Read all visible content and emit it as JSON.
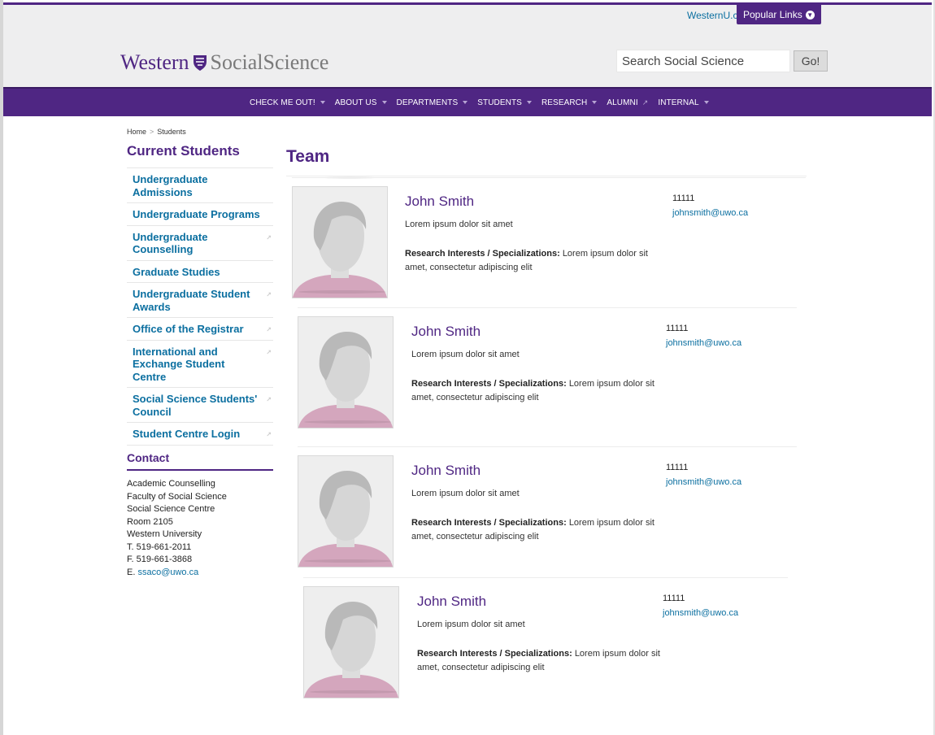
{
  "header": {
    "utility_link": "WesternU.ca",
    "popular_links": "Popular Links",
    "logo_western": "Western",
    "logo_social": "SocialScience",
    "search_placeholder": "Search Social Science",
    "go_label": "Go!"
  },
  "nav": {
    "items": [
      {
        "label": "CHECK ME OUT!",
        "icon": "caret-down-icon"
      },
      {
        "label": "ABOUT US",
        "icon": "caret-down-icon"
      },
      {
        "label": "DEPARTMENTS",
        "icon": "caret-down-icon"
      },
      {
        "label": "STUDENTS",
        "icon": "caret-down-icon"
      },
      {
        "label": "RESEARCH",
        "icon": "caret-down-icon"
      },
      {
        "label": "ALUMNI",
        "icon": "external-link-icon"
      },
      {
        "label": "INTERNAL",
        "icon": "caret-down-icon"
      }
    ]
  },
  "breadcrumb": {
    "home": "Home",
    "sep": ">",
    "current": "Students"
  },
  "sidebar": {
    "title": "Current Students",
    "items": [
      {
        "label": "Undergraduate Admissions",
        "external": false
      },
      {
        "label": "Undergraduate Programs",
        "external": false
      },
      {
        "label": "Undergraduate Counselling",
        "external": true
      },
      {
        "label": "Graduate Studies",
        "external": false
      },
      {
        "label": "Undergraduate Student Awards",
        "external": true
      },
      {
        "label": "Office of the Registrar",
        "external": true
      },
      {
        "label": "International and Exchange Student Centre",
        "external": true
      },
      {
        "label": "Social Science Students' Council",
        "external": true
      },
      {
        "label": "Student Centre Login",
        "external": true
      }
    ],
    "contact_title": "Contact",
    "contact_lines": [
      "Academic Counselling",
      "Faculty of Social Science",
      "Social Science Centre",
      "Room 2105",
      "Western University",
      "T. 519-661-2011",
      "F. 519-661-3868"
    ],
    "contact_email_prefix": "E.",
    "contact_email": "ssaco@uwo.ca"
  },
  "main": {
    "title": "Team",
    "members": [
      {
        "name": "John Smith",
        "subtitle": "Lorem ipsum dolor sit amet",
        "research_label": "Research Interests / Specializations:",
        "research_text": "Lorem ipsum dolor sit amet, consectetur adipiscing elit",
        "phone": "11111",
        "email": "johnsmith@uwo.ca"
      },
      {
        "name": "John Smith",
        "subtitle": "Lorem ipsum dolor sit amet",
        "research_label": "Research Interests / Specializations:",
        "research_text": "Lorem ipsum dolor sit amet, consectetur adipiscing elit",
        "phone": "11111",
        "email": "johnsmith@uwo.ca"
      },
      {
        "name": "John Smith",
        "subtitle": "Lorem ipsum dolor sit amet",
        "research_label": "Research Interests / Specializations:",
        "research_text": "Lorem ipsum dolor sit amet, consectetur adipiscing elit",
        "phone": "11111",
        "email": "johnsmith@uwo.ca"
      },
      {
        "name": "John Smith",
        "subtitle": "Lorem ipsum dolor sit amet",
        "research_label": "Research Interests / Specializations:",
        "research_text": "Lorem ipsum dolor sit amet, consectetur adipiscing elit",
        "phone": "11111",
        "email": "johnsmith@uwo.ca"
      }
    ]
  },
  "colors": {
    "brand_purple": "#4f2683",
    "link_blue": "#0b6fa0",
    "header_bg": "#eeeeef",
    "avatar_shirt": "#d4a6bd"
  }
}
